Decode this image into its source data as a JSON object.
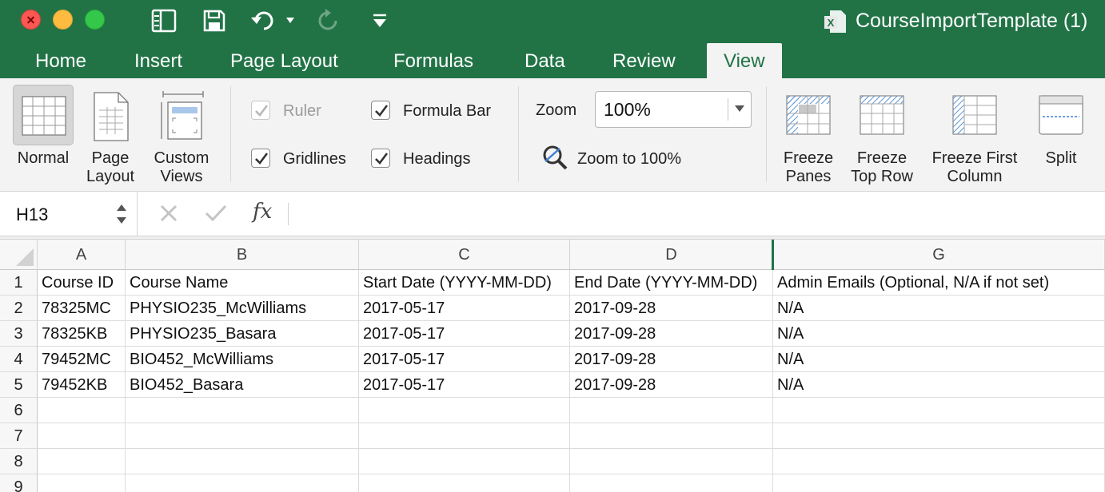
{
  "window": {
    "title": "CourseImportTemplate (1)"
  },
  "colors": {
    "accent": "#217346",
    "ribbon_bg": "#f3f3f3"
  },
  "tabs": [
    {
      "label": "Home"
    },
    {
      "label": "Insert"
    },
    {
      "label": "Page Layout"
    },
    {
      "label": "Formulas"
    },
    {
      "label": "Data"
    },
    {
      "label": "Review"
    },
    {
      "label": "View",
      "active": true
    }
  ],
  "ribbon": {
    "views": {
      "normal": {
        "label_line1": "Normal"
      },
      "page_layout": {
        "label_line1": "Page",
        "label_line2": "Layout"
      },
      "custom_views": {
        "label_line1": "Custom",
        "label_line2": "Views"
      }
    },
    "show": {
      "ruler": {
        "label": "Ruler",
        "checked": true,
        "disabled": true
      },
      "formula_bar": {
        "label": "Formula Bar",
        "checked": true
      },
      "gridlines": {
        "label": "Gridlines",
        "checked": true
      },
      "headings": {
        "label": "Headings",
        "checked": true
      }
    },
    "zoom": {
      "label": "Zoom",
      "value": "100%",
      "zoom_to_100_label": "Zoom to 100%"
    },
    "window": {
      "freeze_panes": {
        "label_line1": "Freeze",
        "label_line2": "Panes"
      },
      "freeze_top_row": {
        "label_line1": "Freeze",
        "label_line2": "Top Row"
      },
      "freeze_first_column": {
        "label_line1": "Freeze First",
        "label_line2": "Column"
      },
      "split": {
        "label_line1": "Split"
      }
    }
  },
  "formula_bar": {
    "name_box": "H13",
    "fx_label": "fx",
    "content": ""
  },
  "sheet": {
    "columns": [
      "A",
      "B",
      "C",
      "D",
      "G"
    ],
    "row_numbers": [
      "1",
      "2",
      "3",
      "4",
      "5",
      "6",
      "7",
      "8",
      "9"
    ],
    "rows": [
      [
        "Course ID",
        "Course Name",
        "Start Date (YYYY-MM-DD)",
        "End Date (YYYY-MM-DD)",
        "Admin Emails (Optional, N/A if not set)"
      ],
      [
        "78325MC",
        "PHYSIO235_McWilliams",
        "2017-05-17",
        "2017-09-28",
        "N/A"
      ],
      [
        "78325KB",
        "PHYSIO235_Basara",
        "2017-05-17",
        "2017-09-28",
        "N/A"
      ],
      [
        "79452MC",
        "BIO452_McWilliams",
        "2017-05-17",
        "2017-09-28",
        "N/A"
      ],
      [
        "79452KB",
        "BIO452_Basara",
        "2017-05-17",
        "2017-09-28",
        "N/A"
      ],
      [
        "",
        "",
        "",
        "",
        ""
      ],
      [
        "",
        "",
        "",
        "",
        ""
      ],
      [
        "",
        "",
        "",
        "",
        ""
      ],
      [
        "",
        "",
        "",
        "",
        ""
      ]
    ]
  }
}
